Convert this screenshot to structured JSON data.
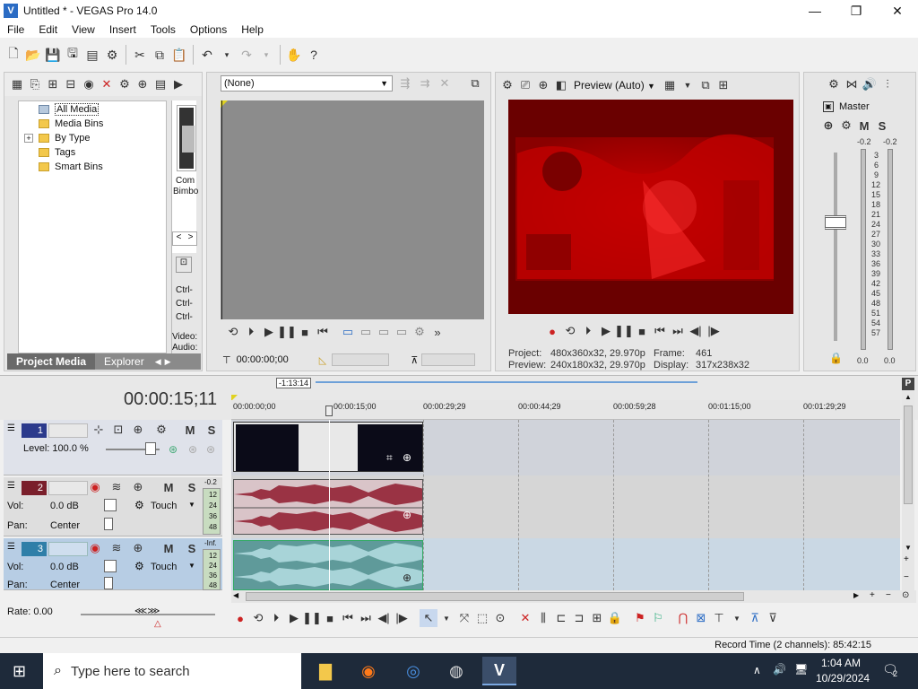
{
  "window": {
    "title": "Untitled * - VEGAS Pro 14.0",
    "app_icon": "V",
    "minimize": "—",
    "maximize": "❐",
    "close": "✕"
  },
  "menu": [
    "File",
    "Edit",
    "View",
    "Insert",
    "Tools",
    "Options",
    "Help"
  ],
  "project_media": {
    "tree": [
      {
        "label": "All Media",
        "selected": true,
        "expander": ""
      },
      {
        "label": "Media Bins",
        "selected": false,
        "expander": ""
      },
      {
        "label": "By Type",
        "selected": false,
        "expander": "+"
      },
      {
        "label": "Tags",
        "selected": false,
        "expander": ""
      },
      {
        "label": "Smart Bins",
        "selected": false,
        "expander": ""
      }
    ],
    "thumb_caption_1": "Com",
    "thumb_caption_2": "Bimbo",
    "nav_prev": "<",
    "nav_next": ">",
    "shortcuts": [
      "Ctrl-",
      "Ctrl-",
      "Ctrl-"
    ],
    "meta_video": "Video:",
    "meta_audio": "Audio:",
    "tabs": [
      "Project Media",
      "Explorer"
    ]
  },
  "trimmer": {
    "dropdown_value": "(None)",
    "timecode": "00:00:00;00"
  },
  "preview": {
    "mode": "Preview (Auto)",
    "project_label": "Project:",
    "project_value": "480x360x32, 29.970p",
    "preview_label": "Preview:",
    "preview_value": "240x180x32, 29.970p",
    "frame_label": "Frame:",
    "frame_value": "461",
    "display_label": "Display:",
    "display_value": "317x238x32"
  },
  "mixer": {
    "name": "Master",
    "mute": "M",
    "solo": "S",
    "peak_left": "-0.2",
    "peak_right": "-0.2",
    "scale": [
      "3",
      "6",
      "9",
      "12",
      "15",
      "18",
      "21",
      "24",
      "27",
      "30",
      "33",
      "36",
      "39",
      "42",
      "45",
      "48",
      "51",
      "54",
      "57"
    ],
    "level_left": "0.0",
    "level_right": "0.0"
  },
  "timeline": {
    "current_time": "00:00:15;11",
    "selection_length": "-1:13:14",
    "ruler": [
      "00:00:00;00",
      "00:00:15;00",
      "00:00:29;29",
      "00:00:44;29",
      "00:00:59;28",
      "00:01:15;00",
      "00:01:29;29"
    ],
    "rate_label": "Rate: 0.00"
  },
  "tracks": [
    {
      "num": "1",
      "kind": "video",
      "level_label": "Level: 100.0 %",
      "mute": "M",
      "solo": "S"
    },
    {
      "num": "2",
      "kind": "audio",
      "vol_label": "Vol:",
      "vol_value": "0.0 dB",
      "pan_label": "Pan:",
      "pan_value": "Center",
      "mode": "Touch",
      "meter_top": "-0.2",
      "meter_marks": [
        "12",
        "24",
        "36",
        "48"
      ],
      "mute": "M",
      "solo": "S"
    },
    {
      "num": "3",
      "kind": "audio",
      "vol_label": "Vol:",
      "vol_value": "0.0 dB",
      "pan_label": "Pan:",
      "pan_value": "Center",
      "mode": "Touch",
      "meter_top": "-Inf.",
      "meter_marks": [
        "12",
        "24",
        "36",
        "48"
      ],
      "mute": "M",
      "solo": "S"
    }
  ],
  "status": {
    "record_time": "Record Time (2 channels): 85:42:15"
  },
  "taskbar": {
    "search_placeholder": "Type here to search",
    "time": "1:04 AM",
    "date": "10/29/2024",
    "notifications": "2"
  },
  "colors": {
    "accent": "#2b6cc4",
    "video_track": "#2b3a8c",
    "audio_track_2": "#7a1f2b",
    "audio_track_3": "#2f7fa8",
    "preview_red": "#c40000",
    "audio_wave_2": "#9a3344",
    "audio_wave_3": "#a8d4d8"
  }
}
